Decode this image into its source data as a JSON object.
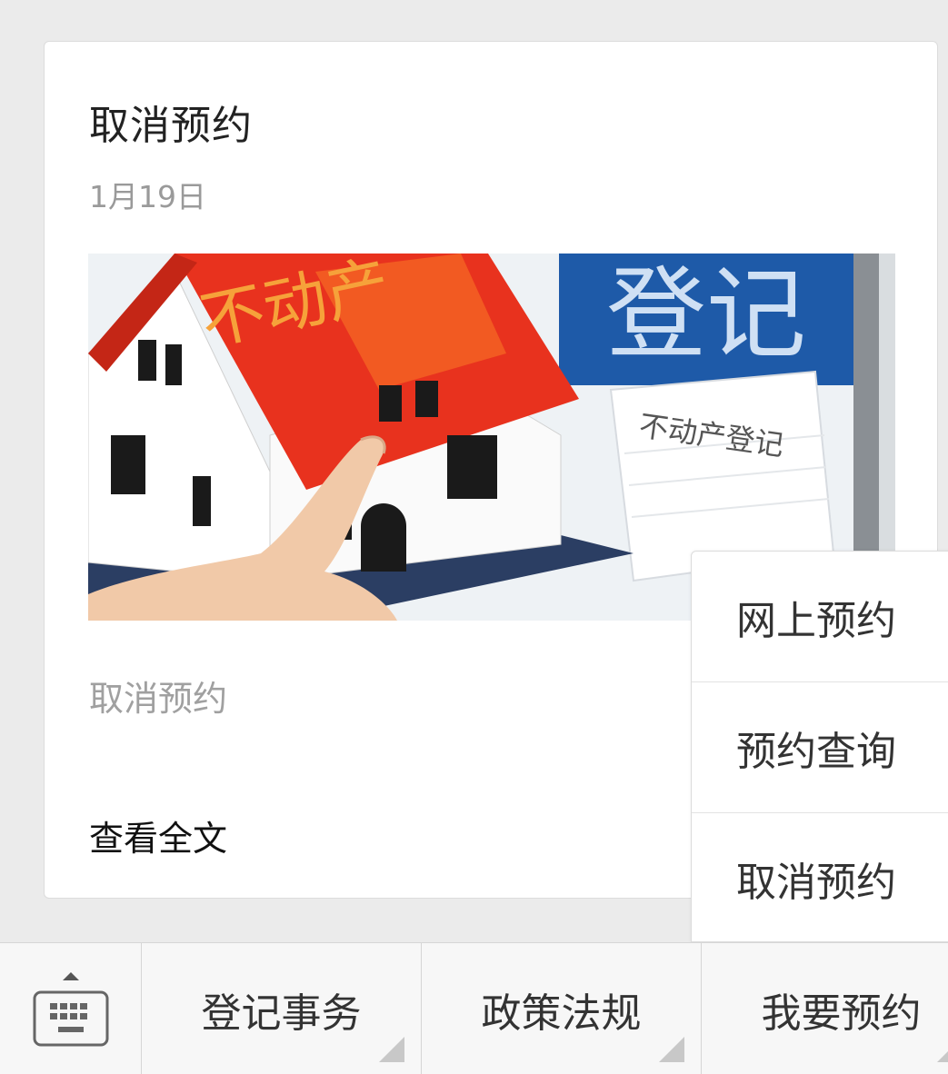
{
  "article": {
    "title": "取消预约",
    "date": "1月19日",
    "image_text_roof": "不动产",
    "image_text_sign": "登记",
    "image_text_paper": "不动产登记",
    "summary": "取消预约",
    "read_more": "查看全文"
  },
  "popup_menu": {
    "items": [
      {
        "label": "网上预约"
      },
      {
        "label": "预约查询"
      },
      {
        "label": "取消预约"
      }
    ]
  },
  "bottom_menu": {
    "keyboard_icon": "keyboard-icon",
    "items": [
      {
        "label": "登记事务"
      },
      {
        "label": "政策法规"
      },
      {
        "label": "我要预约"
      }
    ]
  },
  "colors": {
    "background": "#ebebeb",
    "card": "#ffffff",
    "roof_red": "#e8321e",
    "sign_blue": "#1e5aa8"
  }
}
